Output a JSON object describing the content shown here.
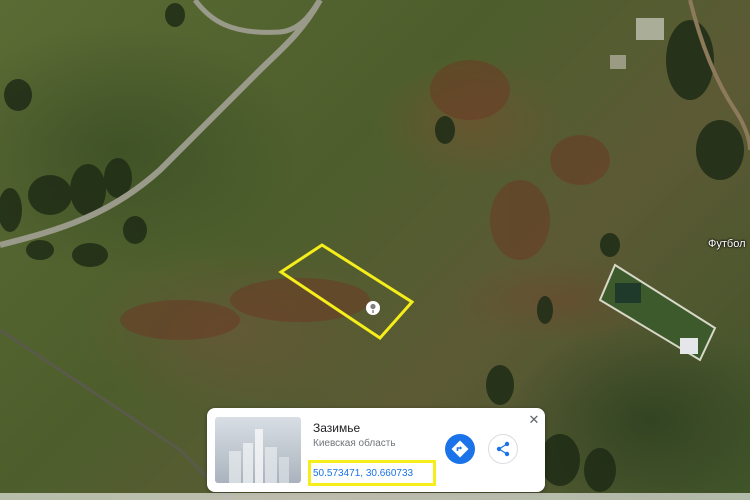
{
  "map": {
    "place_label": "Футбол"
  },
  "card": {
    "title": "Зазимье",
    "subtitle": "Киевская область",
    "coordinates": "50.573471, 30.660733",
    "close_icon": "close-icon",
    "directions_icon": "directions-icon",
    "share_icon": "share-icon"
  },
  "colors": {
    "highlight": "#f5ee1a",
    "accent": "#1a73e8"
  }
}
